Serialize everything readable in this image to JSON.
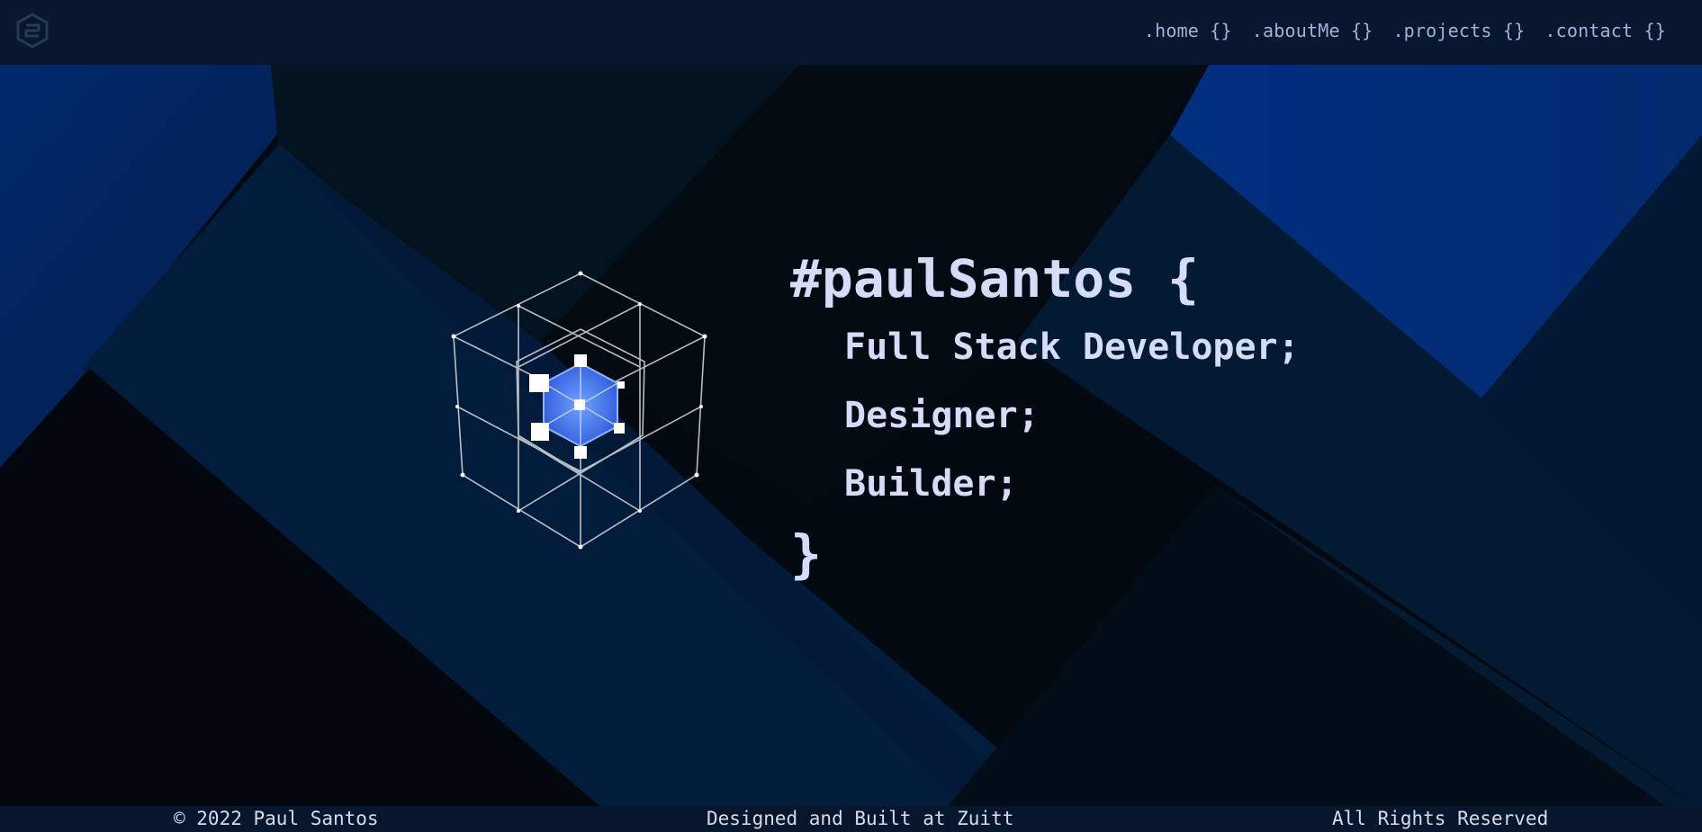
{
  "nav": {
    "items": [
      {
        "label": ".home {}"
      },
      {
        "label": ".aboutMe {}"
      },
      {
        "label": ".projects {}"
      },
      {
        "label": ".contact {}"
      }
    ]
  },
  "hero": {
    "title": "#paulSantos {",
    "lines": [
      "Full Stack Developer;",
      "Designer;",
      "Builder;"
    ],
    "closing": "}",
    "graphic_icon": "wireframe-cube-icon"
  },
  "footer": {
    "copyright": "© 2022 Paul Santos",
    "credit": "Designed and Built at Zuitt",
    "rights": "All Rights Reserved"
  },
  "colors": {
    "topbar": "#081630",
    "text": "#d4dcf7",
    "nav_text": "#9fb3d6",
    "accent_blue": "#1f4fd6"
  }
}
